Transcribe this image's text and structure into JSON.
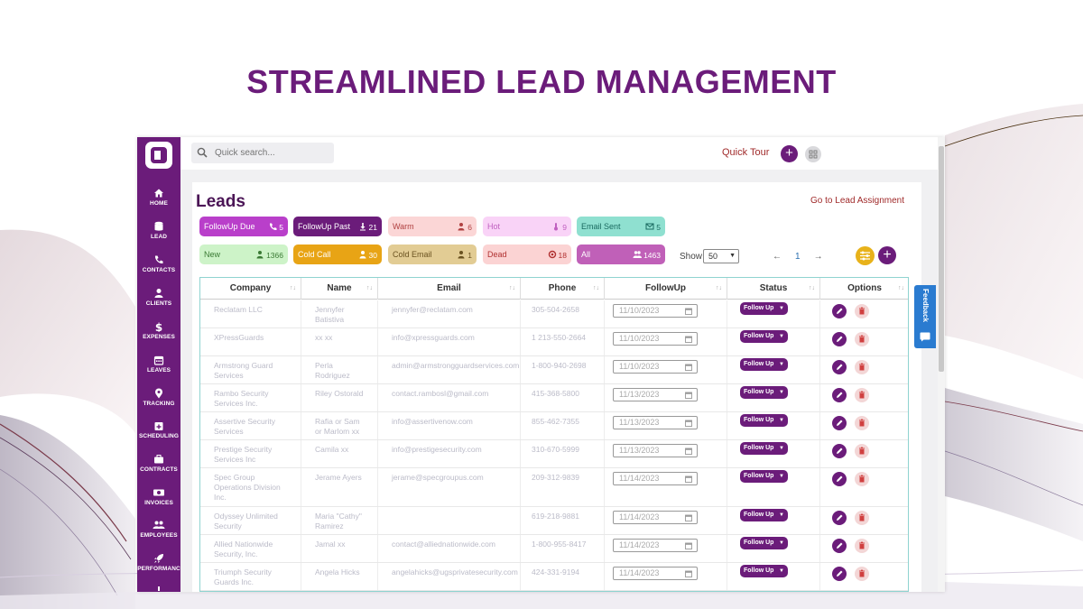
{
  "headline": "STREAMLINED LEAD MANAGEMENT",
  "colors": {
    "brand": "#6b1c7a",
    "accent_link": "#a02a2a",
    "table_border": "#8fd3d0",
    "feedback": "#2a7bd0"
  },
  "sidebar": {
    "logo_icon": "app-logo",
    "items": [
      {
        "label": "HOME",
        "icon": "home-icon"
      },
      {
        "label": "LEAD",
        "icon": "database-icon"
      },
      {
        "label": "CONTACTS",
        "icon": "phone-icon"
      },
      {
        "label": "CLIENTS",
        "icon": "user-icon"
      },
      {
        "label": "EXPENSES",
        "icon": "dollar-icon"
      },
      {
        "label": "LEAVES",
        "icon": "calendar-icon"
      },
      {
        "label": "TRACKING",
        "icon": "map-pin-icon"
      },
      {
        "label": "SCHEDULING",
        "icon": "calendar-plus-icon"
      },
      {
        "label": "CONTRACTS",
        "icon": "briefcase-icon"
      },
      {
        "label": "INVOICES",
        "icon": "money-icon"
      },
      {
        "label": "EMPLOYEES",
        "icon": "users-icon"
      },
      {
        "label": "PERFORMANC",
        "icon": "rocket-icon"
      }
    ]
  },
  "topbar": {
    "search_placeholder": "Quick search...",
    "quick_tour": "Quick Tour"
  },
  "page": {
    "title": "Leads",
    "goto_link": "Go to Lead Assignment"
  },
  "chips": [
    {
      "label": "FollowUp Due",
      "count": "5",
      "icon": "phone-icon",
      "bg": "#b93fca",
      "fg": "#ffffff"
    },
    {
      "label": "FollowUp Past",
      "count": "21",
      "icon": "download-icon",
      "bg": "#6b1c7a",
      "fg": "#ffffff"
    },
    {
      "label": "Warm",
      "count": "6",
      "icon": "user-icon",
      "bg": "#fbd6d6",
      "fg": "#b04040"
    },
    {
      "label": "Hot",
      "count": "9",
      "icon": "thermometer-icon",
      "bg": "#f9d3f7",
      "fg": "#c060c0"
    },
    {
      "label": "Email Sent",
      "count": "5",
      "icon": "mail-icon",
      "bg": "#8fe0d0",
      "fg": "#1a6a60"
    },
    {
      "label": "New",
      "count": "1366",
      "icon": "user-icon",
      "bg": "#cdf3c8",
      "fg": "#3a7a34"
    },
    {
      "label": "Cold Call",
      "count": "30",
      "icon": "user-icon",
      "bg": "#e8a415",
      "fg": "#ffffff"
    },
    {
      "label": "Cold Email",
      "count": "1",
      "icon": "user-icon",
      "bg": "#e2cc94",
      "fg": "#6a5220"
    },
    {
      "label": "Dead",
      "count": "18",
      "icon": "ban-icon",
      "bg": "#fbd3d3",
      "fg": "#b03030"
    },
    {
      "label": "All",
      "count": "1463",
      "icon": "users-icon",
      "bg": "#c060b8",
      "fg": "#ffffff"
    }
  ],
  "controls": {
    "show_label": "Show",
    "page_size": "50",
    "prev": "←",
    "page": "1",
    "next": "→"
  },
  "table": {
    "columns": [
      "Company",
      "Name",
      "Email",
      "Phone",
      "FollowUp",
      "Status",
      "Options"
    ],
    "status_label": "Follow Up",
    "rows": [
      {
        "company": [
          "Reclatam LLC"
        ],
        "name": [
          "Jennyfer",
          "Batistiva"
        ],
        "email": "jennyfer@reclatam.com",
        "phone": "305-504-2658",
        "followup": "11/10/2023"
      },
      {
        "company": [
          "XPressGuards"
        ],
        "name": [
          "xx xx"
        ],
        "email": "info@xpressguards.com",
        "phone": "1 213-550-2664",
        "followup": "11/10/2023"
      },
      {
        "company": [
          "Armstrong Guard",
          "Services"
        ],
        "name": [
          "Perla",
          "Rodriguez"
        ],
        "email": "admin@armstrongguardservices.com",
        "phone": "1-800-940-2698",
        "followup": "11/10/2023"
      },
      {
        "company": [
          "Rambo Security",
          "Services Inc."
        ],
        "name": [
          "Riley Ostorald"
        ],
        "email": "contact.rambosl@gmail.com",
        "phone": "415-368-5800",
        "followup": "11/13/2023"
      },
      {
        "company": [
          "Assertive Security",
          "Services"
        ],
        "name": [
          "Rafia or Sam",
          "or Marlom xx"
        ],
        "email": "info@assertivenow.com",
        "phone": "855-462-7355",
        "followup": "11/13/2023"
      },
      {
        "company": [
          "Prestige Security",
          "Services Inc"
        ],
        "name": [
          "Camila xx"
        ],
        "email": "info@prestigesecurity.com",
        "phone": "310-670-5999",
        "followup": "11/13/2023"
      },
      {
        "company": [
          "Spec Group",
          "Operations Division",
          "Inc."
        ],
        "name": [
          "Jerame Ayers"
        ],
        "email": "jerame@specgroupus.com",
        "phone": "209-312-9839",
        "followup": "11/14/2023"
      },
      {
        "company": [
          "Odyssey Unlimited",
          "Security"
        ],
        "name": [
          "Maria \"Cathy\"",
          "Ramirez"
        ],
        "email": "",
        "phone": "619-218-9881",
        "followup": "11/14/2023"
      },
      {
        "company": [
          "Allied Nationwide",
          "Security, Inc."
        ],
        "name": [
          "Jamal xx"
        ],
        "email": "contact@alliednationwide.com",
        "phone": "1-800-955-8417",
        "followup": "11/14/2023"
      },
      {
        "company": [
          "Triumph Security",
          "Guards Inc."
        ],
        "name": [
          "Angela Hicks"
        ],
        "email": "angelahicks@ugsprivatesecurity.com",
        "phone": "424-331-9194",
        "followup": "11/14/2023"
      }
    ]
  },
  "feedback": {
    "label": "Feedback",
    "icon": "chat-icon"
  }
}
